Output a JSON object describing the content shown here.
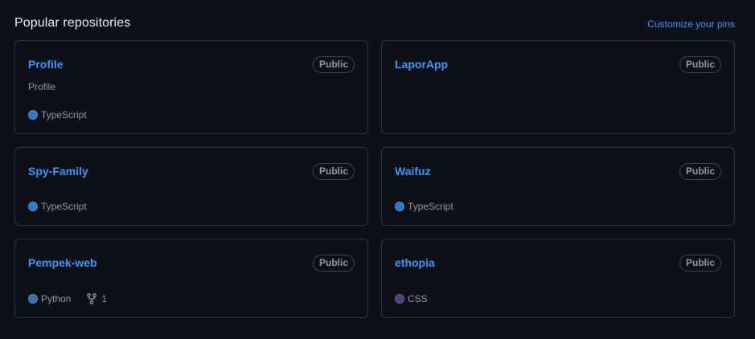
{
  "header": {
    "title": "Popular repositories",
    "customize_label": "Customize your pins"
  },
  "colors": {
    "TypeScript": "#3178c6",
    "Python": "#3572A5",
    "CSS": "#563d7c",
    "link": "#4493f8"
  },
  "repos": [
    {
      "name": "Profile",
      "visibility": "Public",
      "description": "Profile",
      "language": "TypeScript",
      "language_color": "#3178c6",
      "forks": ""
    },
    {
      "name": "LaporApp",
      "visibility": "Public",
      "description": "",
      "language": "",
      "language_color": "",
      "forks": ""
    },
    {
      "name": "Spy-Family",
      "visibility": "Public",
      "description": "",
      "language": "TypeScript",
      "language_color": "#3178c6",
      "forks": ""
    },
    {
      "name": "Waifuz",
      "visibility": "Public",
      "description": "",
      "language": "TypeScript",
      "language_color": "#3178c6",
      "forks": ""
    },
    {
      "name": "Pempek-web",
      "visibility": "Public",
      "description": "",
      "language": "Python",
      "language_color": "#3572A5",
      "forks": "1"
    },
    {
      "name": "ethopia",
      "visibility": "Public",
      "description": "",
      "language": "CSS",
      "language_color": "#563d7c",
      "forks": ""
    }
  ]
}
